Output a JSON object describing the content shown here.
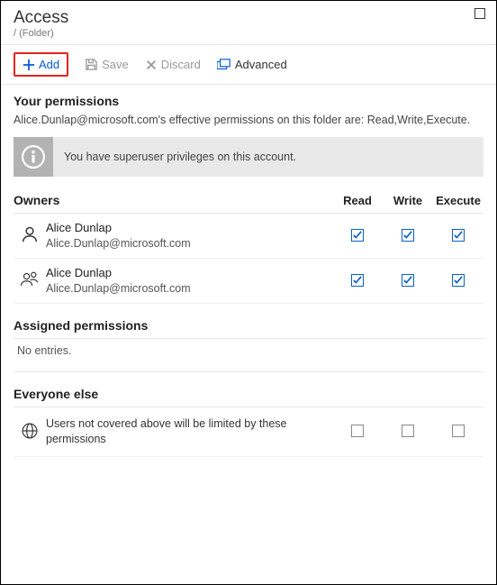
{
  "header": {
    "title": "Access",
    "subtitle": "/ (Folder)"
  },
  "toolbar": {
    "add": "Add",
    "save": "Save",
    "discard": "Discard",
    "advanced": "Advanced"
  },
  "permissions": {
    "heading": "Your permissions",
    "description": "Alice.Dunlap@microsoft.com's effective permissions on this folder are: Read,Write,Execute.",
    "banner": "You have superuser privileges on this account."
  },
  "owners": {
    "heading": "Owners",
    "cols": {
      "read": "Read",
      "write": "Write",
      "execute": "Execute"
    },
    "rows": [
      {
        "name": "Alice Dunlap",
        "email": "Alice.Dunlap@microsoft.com",
        "read": true,
        "write": true,
        "execute": true,
        "icon": "user"
      },
      {
        "name": "Alice Dunlap",
        "email": "Alice.Dunlap@microsoft.com",
        "read": true,
        "write": true,
        "execute": true,
        "icon": "group"
      }
    ]
  },
  "assigned": {
    "heading": "Assigned permissions",
    "empty": "No entries."
  },
  "everyone": {
    "heading": "Everyone else",
    "label": "Users not covered above will be limited by these permissions",
    "read": false,
    "write": false,
    "execute": false
  }
}
